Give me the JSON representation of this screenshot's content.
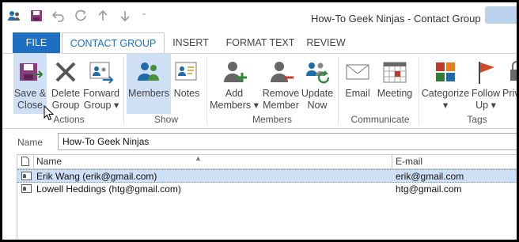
{
  "window": {
    "title": "How-To Geek Ninjas - Contact Group"
  },
  "qat": {
    "dropdown": "⁼"
  },
  "tabs": [
    {
      "label": "FILE"
    },
    {
      "label": "CONTACT GROUP"
    },
    {
      "label": "INSERT"
    },
    {
      "label": "FORMAT TEXT"
    },
    {
      "label": "REVIEW"
    }
  ],
  "ribbon": {
    "save_close": {
      "line1": "Save &",
      "line2": "Close"
    },
    "delete_group": {
      "line1": "Delete",
      "line2": "Group"
    },
    "forward_group": {
      "line1": "Forward",
      "line2": "Group ▾"
    },
    "members": {
      "label": "Members"
    },
    "notes": {
      "label": "Notes"
    },
    "add_members": {
      "line1": "Add",
      "line2": "Members ▾"
    },
    "remove_member": {
      "line1": "Remove",
      "line2": "Member"
    },
    "update_now": {
      "line1": "Update",
      "line2": "Now"
    },
    "email": {
      "label": "Email"
    },
    "meeting": {
      "label": "Meeting"
    },
    "categorize": {
      "line1": "Categorize",
      "line2": "▾"
    },
    "follow_up": {
      "line1": "Follow",
      "line2": "Up ▾"
    },
    "private": {
      "line1": "Priv",
      "line2": ""
    },
    "groups": {
      "actions": "Actions",
      "show": "Show",
      "members": "Members",
      "communicate": "Communicate",
      "tags": "Tags"
    },
    "colors": {
      "selected": "#cfe0f4",
      "accent": "#1e6fc1"
    }
  },
  "name_field": {
    "label": "Name",
    "value": "How-To Geek Ninjas"
  },
  "list": {
    "columns": {
      "name": "Name",
      "email": "E-mail",
      "sort_indicator": "▲"
    },
    "rows": [
      {
        "name": "Erik Wang (erik@gmail.com)",
        "email": "erik@gmail.com",
        "selected": true
      },
      {
        "name": "Lowell Heddings (htg@gmail.com)",
        "email": "htg@gmail.com",
        "selected": false
      }
    ]
  }
}
